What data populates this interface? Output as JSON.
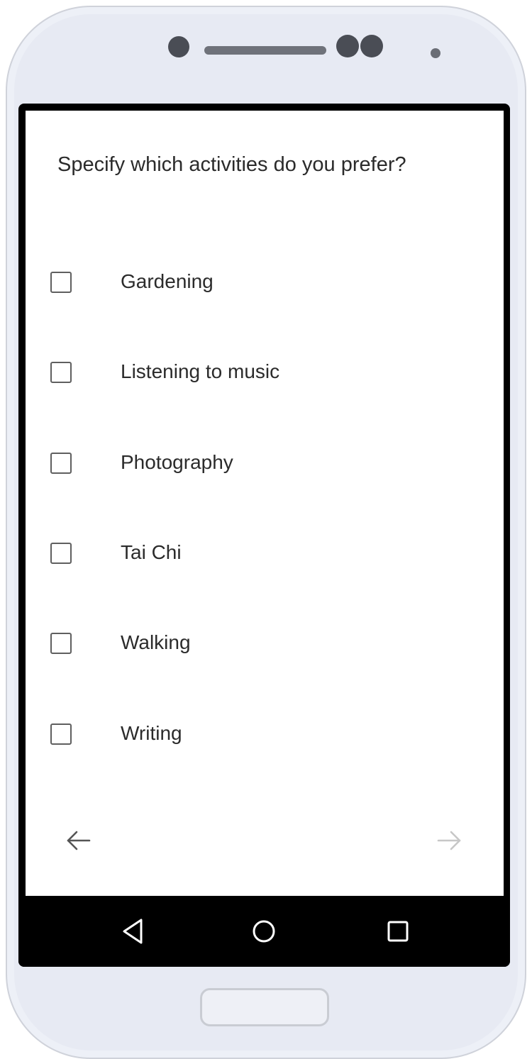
{
  "question": {
    "text": "Specify which activities do you prefer?"
  },
  "options": [
    {
      "label": "Gardening",
      "checked": false
    },
    {
      "label": "Listening to music",
      "checked": false
    },
    {
      "label": "Photography",
      "checked": false
    },
    {
      "label": "Tai Chi",
      "checked": false
    },
    {
      "label": "Walking",
      "checked": false
    },
    {
      "label": "Writing",
      "checked": false
    }
  ],
  "navigation": {
    "back_icon": "arrow-left-icon",
    "next_icon": "arrow-right-icon",
    "next_enabled": false
  },
  "system_nav": {
    "back_icon": "triangle-back-icon",
    "home_icon": "circle-home-icon",
    "recents_icon": "square-recents-icon"
  },
  "colors": {
    "text": "#2b2b2b",
    "checkbox_border": "#5f5f5f",
    "arrow_active": "#555555",
    "arrow_disabled": "#c7c7c7",
    "phone_body": "#e7eaf3",
    "screen_bezel": "#000000"
  }
}
